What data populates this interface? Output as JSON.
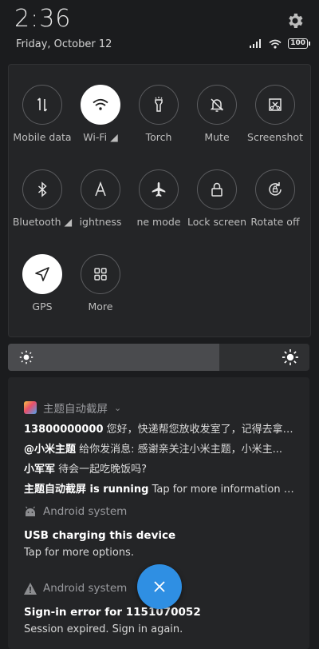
{
  "status": {
    "time": "2:36",
    "date": "Friday, October 12",
    "battery": "100"
  },
  "toggles": [
    {
      "label": "Mobile data",
      "icon": "mobile-data-icon",
      "on": false
    },
    {
      "label": "Wi-Fi ◢",
      "icon": "wifi-icon",
      "on": true
    },
    {
      "label": "Torch",
      "icon": "torch-icon",
      "on": false
    },
    {
      "label": "Mute",
      "icon": "mute-icon",
      "on": false
    },
    {
      "label": "Screenshot",
      "icon": "screenshot-icon",
      "on": false
    },
    {
      "label": "Bluetooth ◢",
      "icon": "bluetooth-icon",
      "on": false
    },
    {
      "label": "ightness",
      "icon": "auto-brightness-icon",
      "on": false
    },
    {
      "label": "ne mode",
      "icon": "airplane-icon",
      "on": false
    },
    {
      "label": "Lock screen",
      "icon": "lock-icon",
      "on": false
    },
    {
      "label": "Rotate off",
      "icon": "rotate-icon",
      "on": false
    },
    {
      "label": "GPS",
      "icon": "gps-icon",
      "on": true
    },
    {
      "label": "More",
      "icon": "more-grid-icon",
      "on": false
    }
  ],
  "brightness": {
    "level": 0.7
  },
  "notifications": {
    "theme": {
      "app_name": "主题自动截屏",
      "lines": [
        {
          "bold": "13800000000",
          "text": " 您好，快递帮您放收发室了，记得去拿哦。"
        },
        {
          "bold": "@小米主题",
          "text": " 给你发消息: 感谢亲关注小米主题，小米主..."
        },
        {
          "bold": "小军军",
          "text": " 待会一起吃晚饭吗?"
        },
        {
          "bold": "主题自动截屏 is running",
          "text": " Tap for more information or t..."
        }
      ]
    },
    "usb": {
      "app_name": "Android system",
      "title": "USB charging this device",
      "text": "Tap for more options."
    },
    "signin": {
      "app_name": "Android system",
      "title": "Sign-in error for 1151070052",
      "text": "Session expired. Sign in again."
    }
  },
  "colors": {
    "accent": "#2f8fe3",
    "background": "#1b1c1e"
  }
}
